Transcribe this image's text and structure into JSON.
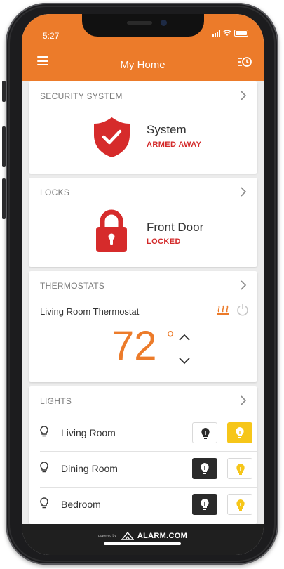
{
  "status_bar": {
    "time": "5:27"
  },
  "header": {
    "title": "My Home",
    "menu_icon": "hamburger-icon",
    "schedule_icon": "schedule-icon"
  },
  "security": {
    "section_title": "SECURITY SYSTEM",
    "device_name": "System",
    "status": "ARMED AWAY"
  },
  "locks": {
    "section_title": "LOCKS",
    "device_name": "Front Door",
    "status": "LOCKED"
  },
  "thermostats": {
    "section_title": "THERMOSTATS",
    "device_name": "Living Room Thermostat",
    "temperature": "72",
    "degree": "°",
    "mode": "heat"
  },
  "lights": {
    "section_title": "LIGHTS",
    "items": [
      {
        "name": "Living Room",
        "state": "on"
      },
      {
        "name": "Dining Room",
        "state": "off"
      },
      {
        "name": "Bedroom",
        "state": "off"
      }
    ]
  },
  "footer": {
    "powered_by": "powered by",
    "brand": "ALARM.COM"
  },
  "colors": {
    "accent": "#ec7b2a",
    "alert_red": "#d32a2a",
    "light_on": "#f6c619",
    "dark_button": "#2b2b2b"
  }
}
